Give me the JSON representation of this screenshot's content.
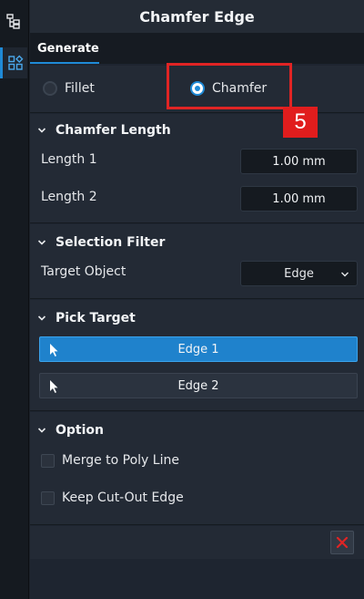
{
  "window": {
    "title": "Chamfer Edge"
  },
  "rail": {
    "icons": [
      "tree-hierarchy-icon",
      "widgets-grid-icon"
    ]
  },
  "tabs": [
    {
      "label": "Generate"
    }
  ],
  "mode": {
    "options": [
      {
        "label": "Fillet",
        "checked": false
      },
      {
        "label": "Chamfer",
        "checked": true
      }
    ]
  },
  "annotation": {
    "step": "5",
    "color": "#e02424"
  },
  "chamfer_length": {
    "title": "Chamfer Length",
    "rows": [
      {
        "label": "Length 1",
        "value": "1.00 mm"
      },
      {
        "label": "Length 2",
        "value": "1.00 mm"
      }
    ]
  },
  "selection_filter": {
    "title": "Selection Filter",
    "target_label": "Target Object",
    "target_value": "Edge"
  },
  "pick_target": {
    "title": "Pick Target",
    "buttons": [
      {
        "label": "Edge 1",
        "active": true
      },
      {
        "label": "Edge 2",
        "active": false
      }
    ]
  },
  "option": {
    "title": "Option",
    "checks": [
      {
        "label": "Merge to Poly Line",
        "checked": false
      },
      {
        "label": "Keep Cut-Out Edge",
        "checked": false
      }
    ]
  },
  "colors": {
    "accent": "#1f8ad6",
    "danger": "#e02424"
  }
}
